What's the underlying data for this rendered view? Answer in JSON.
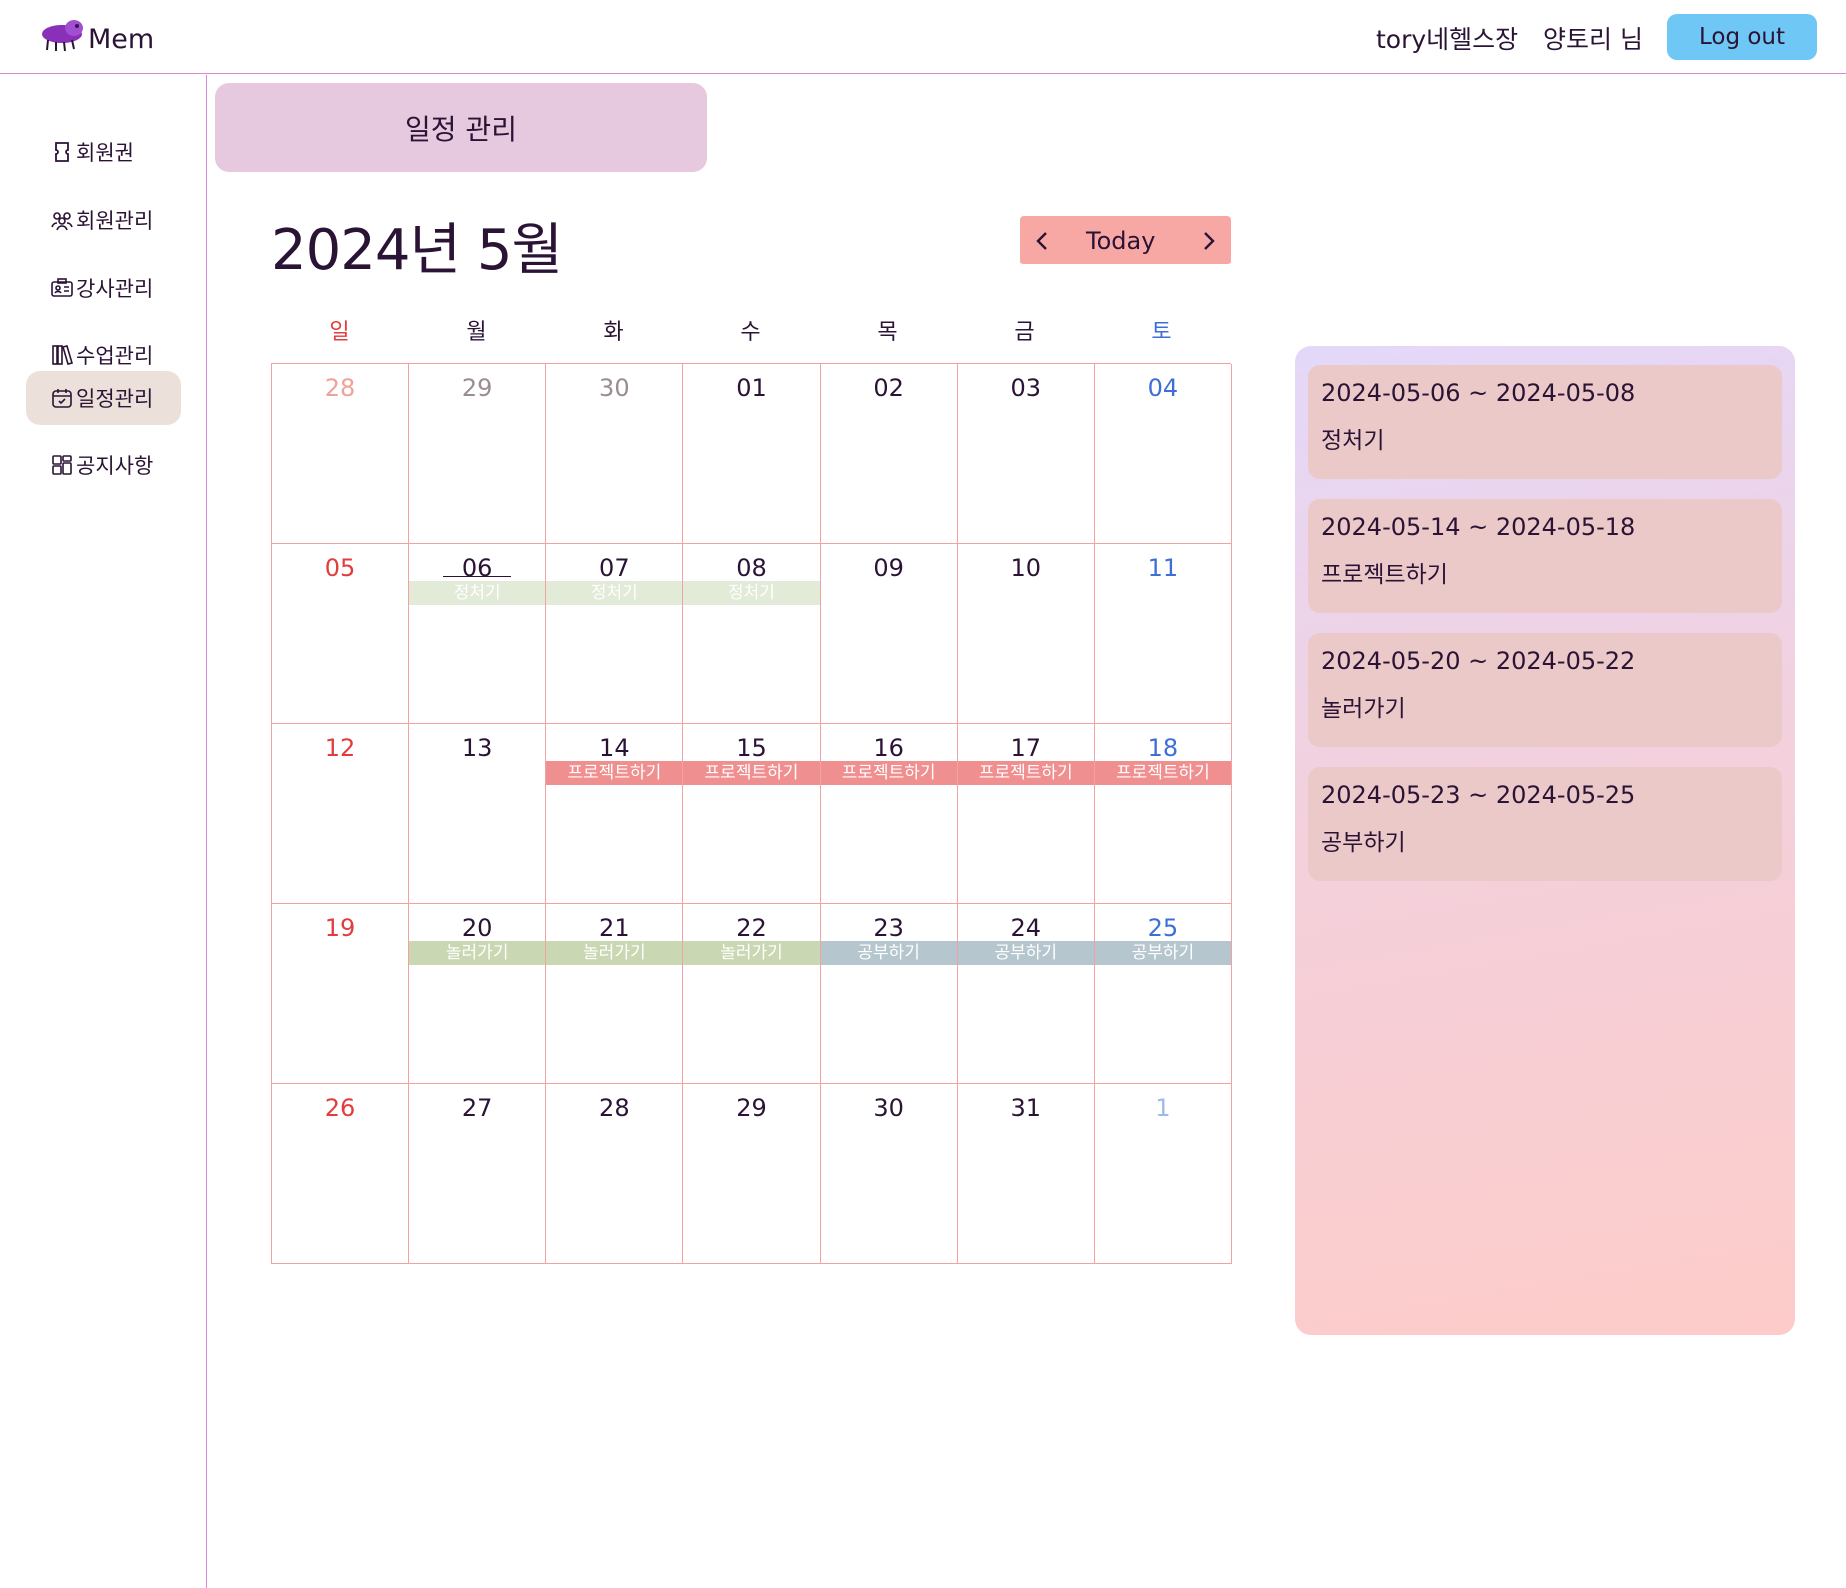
{
  "header": {
    "logo_text": "Mem",
    "gym_name": "tory네헬스장",
    "user_name": "양토리 님",
    "logout_label": "Log out"
  },
  "sidebar": {
    "items": [
      {
        "label": "회원권",
        "icon": "ticket-icon",
        "active": false
      },
      {
        "label": "회원관리",
        "icon": "users-icon",
        "active": false
      },
      {
        "label": "강사관리",
        "icon": "id-card-icon",
        "active": false
      },
      {
        "label": "수업관리",
        "icon": "books-icon",
        "active": false
      },
      {
        "label": "일정관리",
        "icon": "calendar-check-icon",
        "active": true
      },
      {
        "label": "공지사항",
        "icon": "dashboard-icon",
        "active": false
      }
    ]
  },
  "page_title": "일정 관리",
  "calendar": {
    "month_title": "2024년 5월",
    "today_label": "Today",
    "weekdays": [
      "일",
      "월",
      "화",
      "수",
      "목",
      "금",
      "토"
    ],
    "weeks": [
      [
        {
          "day": "28",
          "other": true
        },
        {
          "day": "29",
          "other": true
        },
        {
          "day": "30",
          "other": true
        },
        {
          "day": "01"
        },
        {
          "day": "02"
        },
        {
          "day": "03"
        },
        {
          "day": "04"
        }
      ],
      [
        {
          "day": "05"
        },
        {
          "day": "06",
          "today": true,
          "event": "정처기",
          "color": "#e2ead8"
        },
        {
          "day": "07",
          "event": "정처기",
          "color": "#e2ead8"
        },
        {
          "day": "08",
          "event": "정처기",
          "color": "#e2ead8"
        },
        {
          "day": "09"
        },
        {
          "day": "10"
        },
        {
          "day": "11"
        }
      ],
      [
        {
          "day": "12"
        },
        {
          "day": "13"
        },
        {
          "day": "14",
          "event": "프로젝트하기",
          "color": "#ef8f8f"
        },
        {
          "day": "15",
          "event": "프로젝트하기",
          "color": "#ef8f8f"
        },
        {
          "day": "16",
          "event": "프로젝트하기",
          "color": "#ef8f8f"
        },
        {
          "day": "17",
          "event": "프로젝트하기",
          "color": "#ef8f8f"
        },
        {
          "day": "18",
          "event": "프로젝트하기",
          "color": "#ef8f8f"
        }
      ],
      [
        {
          "day": "19"
        },
        {
          "day": "20",
          "event": "놀러가기",
          "color": "#c9d8b2"
        },
        {
          "day": "21",
          "event": "놀러가기",
          "color": "#c9d8b2"
        },
        {
          "day": "22",
          "event": "놀러가기",
          "color": "#c9d8b2"
        },
        {
          "day": "23",
          "event": "공부하기",
          "color": "#b6c6ce"
        },
        {
          "day": "24",
          "event": "공부하기",
          "color": "#b6c6ce"
        },
        {
          "day": "25",
          "event": "공부하기",
          "color": "#b6c6ce"
        }
      ],
      [
        {
          "day": "26"
        },
        {
          "day": "27"
        },
        {
          "day": "28"
        },
        {
          "day": "29"
        },
        {
          "day": "30"
        },
        {
          "day": "31"
        },
        {
          "day": "1",
          "other": true
        }
      ]
    ]
  },
  "events": [
    {
      "range": "2024-05-06 ~ 2024-05-08",
      "title": "정처기"
    },
    {
      "range": "2024-05-14 ~ 2024-05-18",
      "title": "프로젝트하기"
    },
    {
      "range": "2024-05-20 ~ 2024-05-22",
      "title": "놀러가기"
    },
    {
      "range": "2024-05-23 ~ 2024-05-25",
      "title": "공부하기"
    }
  ],
  "colors": {
    "accent_logout": "#6ec7f4",
    "nav_box": "#f7a8a4",
    "page_title_bg": "#e6c9df",
    "sunday": "#e23c3c",
    "saturday": "#3d6fd6",
    "grid_line": "#f1a3a3"
  }
}
